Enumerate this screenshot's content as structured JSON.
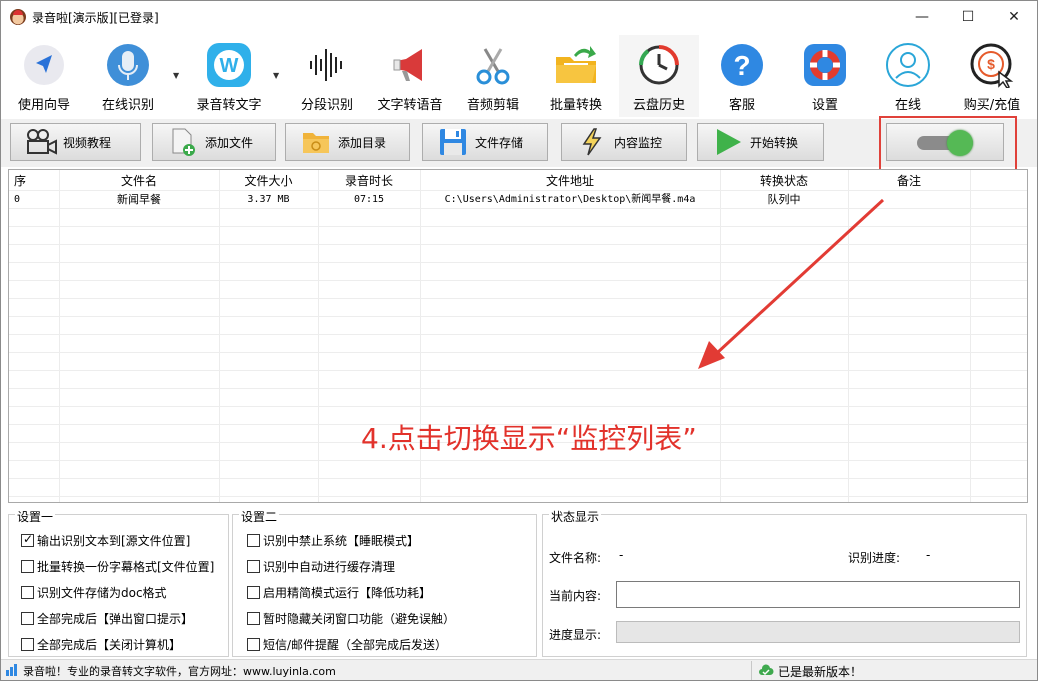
{
  "window": {
    "title": "录音啦[演示版][已登录]",
    "min": "—",
    "max": "☐",
    "close": "✕"
  },
  "toolbar": [
    {
      "label": "使用向导",
      "icon": "navigation-arrow-icon"
    },
    {
      "label": "在线识别",
      "icon": "microphone-icon",
      "dropdown": true
    },
    {
      "label": "录音转文字",
      "icon": "w-cloud-icon",
      "dropdown": true
    },
    {
      "label": "分段识别",
      "icon": "waveform-icon"
    },
    {
      "label": "文字转语音",
      "icon": "megaphone-icon"
    },
    {
      "label": "音频剪辑",
      "icon": "scissors-icon"
    },
    {
      "label": "批量转换",
      "icon": "folder-arrow-icon"
    },
    {
      "label": "云盘历史",
      "icon": "history-clock-icon"
    },
    {
      "label": "客服",
      "icon": "question-icon"
    },
    {
      "label": "设置",
      "icon": "lifebuoy-icon"
    },
    {
      "label": "在线",
      "icon": "user-icon"
    },
    {
      "label": "购买/充值",
      "icon": "dollar-cursor-icon"
    }
  ],
  "buttons": {
    "tutorial": "视频教程",
    "add_file": "添加文件",
    "add_dir": "添加目录",
    "save": "文件存储",
    "monitor": "内容监控",
    "start": "开始转换"
  },
  "table": {
    "columns": [
      "序",
      "文件名",
      "文件大小",
      "录音时长",
      "文件地址",
      "转换状态",
      "备注"
    ],
    "rows": [
      [
        "0",
        "新闻早餐",
        "3.37 MB",
        "07:15",
        "C:\\Users\\Administrator\\Desktop\\新闻早餐.m4a",
        "队列中",
        ""
      ]
    ]
  },
  "annotation": "4.点击切换显示“监控列表”",
  "settings1": {
    "title": "设置一",
    "items": [
      {
        "label": "输出识别文本到[源文件位置]",
        "checked": true
      },
      {
        "label": "批量转换一份字幕格式[文件位置]",
        "checked": false
      },
      {
        "label": "识别文件存储为doc格式",
        "checked": false
      },
      {
        "label": "全部完成后【弹出窗口提示】",
        "checked": false
      },
      {
        "label": "全部完成后【关闭计算机】",
        "checked": false
      }
    ]
  },
  "settings2": {
    "title": "设置二",
    "items": [
      {
        "label": "识别中禁止系统【睡眠模式】",
        "checked": false
      },
      {
        "label": "识别中自动进行缓存清理",
        "checked": false
      },
      {
        "label": "启用精简模式运行【降低功耗】",
        "checked": false
      },
      {
        "label": "暂时隐藏关闭窗口功能（避免误触）",
        "checked": false
      },
      {
        "label": "短信/邮件提醒（全部完成后发送）",
        "checked": false
      }
    ]
  },
  "status": {
    "title": "状态显示",
    "file_name_label": "文件名称:",
    "file_name_value": "-",
    "progress_label": "识别进度:",
    "progress_value": "-",
    "current_label": "当前内容:",
    "bar_label": "进度显示:"
  },
  "statusbar": {
    "left": "录音啦！专业的录音转文字软件，官方网址：www.luyinla.com",
    "right": "已是最新版本！"
  },
  "colors": {
    "accent_red": "#e2322b",
    "toggle_green": "#55b955"
  }
}
